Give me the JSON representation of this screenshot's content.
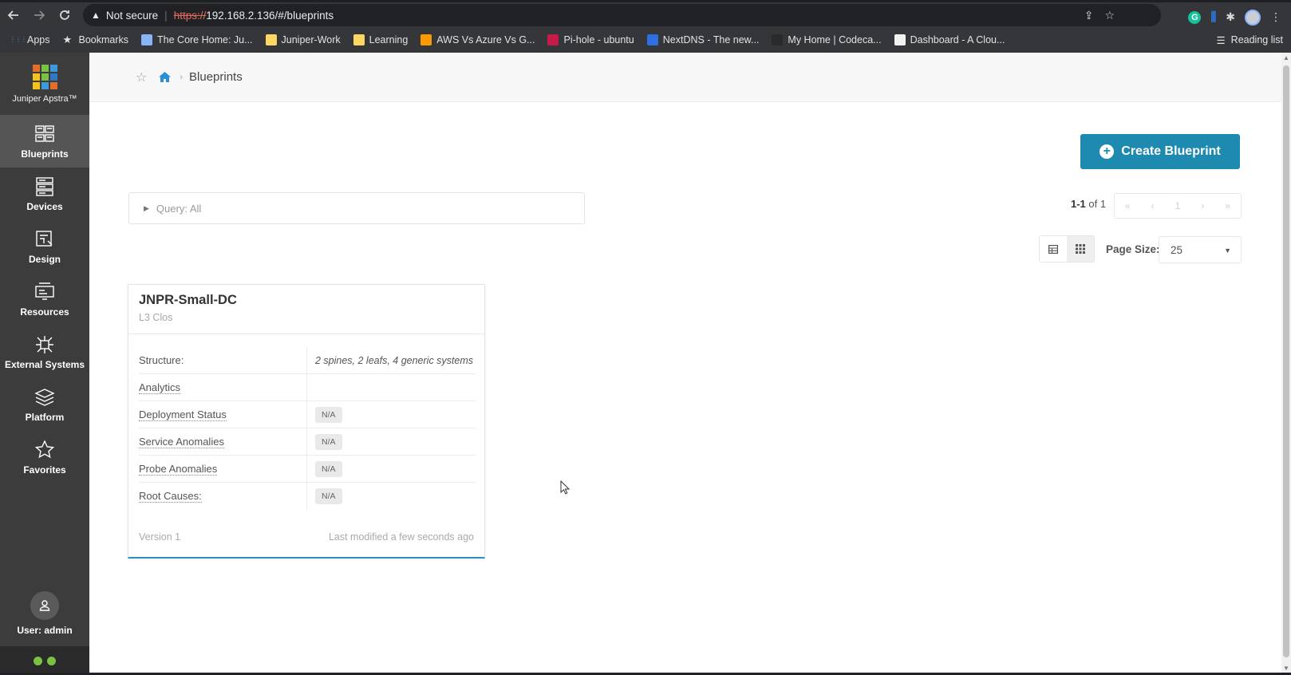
{
  "browser": {
    "not_secure": "Not secure",
    "url_scheme": "https://",
    "url_rest": "192.168.2.136/#/blueprints"
  },
  "bookmarks": [
    {
      "label": "Apps",
      "color": "#4285f4"
    },
    {
      "label": "Bookmarks",
      "color": "#e3e3e3"
    },
    {
      "label": "The Core Home: Ju...",
      "color": "#8ab4f8"
    },
    {
      "label": "Juniper-Work",
      "color": "#fdd663"
    },
    {
      "label": "Learning",
      "color": "#fdd663"
    },
    {
      "label": "AWS Vs Azure Vs G...",
      "color": "#ff9900"
    },
    {
      "label": "Pi-hole - ubuntu",
      "color": "#c51a4a"
    },
    {
      "label": "NextDNS - The new...",
      "color": "#2f6fe4"
    },
    {
      "label": "My Home | Codeca...",
      "color": "#2a2a2a"
    },
    {
      "label": "Dashboard - A Clou...",
      "color": "#f2f2f2"
    }
  ],
  "reading_list": "Reading list",
  "sidebar": {
    "logo_text": "Juniper Apstra™",
    "items": [
      {
        "label": "Blueprints",
        "icon": "blueprints-icon",
        "active": true
      },
      {
        "label": "Devices",
        "icon": "devices-icon",
        "active": false
      },
      {
        "label": "Design",
        "icon": "design-icon",
        "active": false
      },
      {
        "label": "Resources",
        "icon": "resources-icon",
        "active": false
      },
      {
        "label": "External Systems",
        "icon": "external-systems-icon",
        "active": false
      },
      {
        "label": "Platform",
        "icon": "platform-icon",
        "active": false
      },
      {
        "label": "Favorites",
        "icon": "favorites-icon",
        "active": false
      }
    ],
    "user_label": "User: admin"
  },
  "breadcrumb": {
    "current": "Blueprints"
  },
  "toolbar": {
    "create_label": "Create Blueprint",
    "query_label": "Query: All",
    "pagination_range": "1-1",
    "pagination_of": "of 1",
    "page_number": "1",
    "page_size_label": "Page Size:",
    "page_size_value": "25"
  },
  "blueprint": {
    "name": "JNPR-Small-DC",
    "type": "L3 Clos",
    "rows": [
      {
        "label": "Structure:",
        "value": "2 spines, 2 leafs, 4 generic systems",
        "badge": false,
        "dotted": false
      },
      {
        "label": "Analytics",
        "value": "",
        "badge": false,
        "dotted": true
      },
      {
        "label": "Deployment Status",
        "value": "N/A",
        "badge": true,
        "dotted": true
      },
      {
        "label": "Service Anomalies",
        "value": "N/A",
        "badge": true,
        "dotted": true
      },
      {
        "label": "Probe Anomalies",
        "value": "N/A",
        "badge": true,
        "dotted": true
      },
      {
        "label": "Root Causes:",
        "value": "N/A",
        "badge": true,
        "dotted": true
      }
    ],
    "version": "Version 1",
    "modified": "Last modified a few seconds ago"
  },
  "colors": {
    "sidebar_bg": "#3c3c3c",
    "accent": "#1f8ab0",
    "status_ok": "#7cc242"
  }
}
